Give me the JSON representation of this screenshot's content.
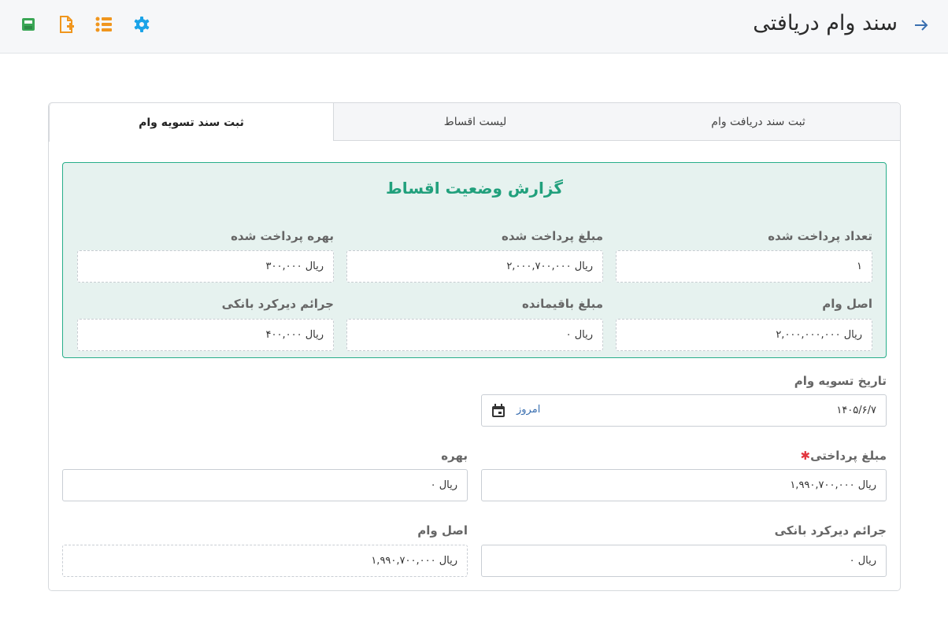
{
  "header": {
    "title": "سند وام دریافتی",
    "back_icon": "arrow-right-icon",
    "toolbar_icons": [
      "settings-icon",
      "list-icon",
      "new-document-icon",
      "save-icon"
    ]
  },
  "tabs": [
    {
      "label": "ثبت سند دریافت وام"
    },
    {
      "label": "لیست اقساط"
    },
    {
      "label": "ثبت سند تسویه وام",
      "active": true
    }
  ],
  "report": {
    "title": "گزارش وضعیت اقساط",
    "fields": [
      {
        "label": "تعداد پرداخت شده",
        "value": "۱"
      },
      {
        "label": "مبلغ پرداخت شده",
        "value": "ریال ۲,۰۰۰,۷۰۰,۰۰۰"
      },
      {
        "label": "بهره پرداخت شده",
        "value": "ریال ۳۰۰,۰۰۰"
      },
      {
        "label": "اصل وام",
        "value": "ریال ۲,۰۰۰,۰۰۰,۰۰۰"
      },
      {
        "label": "مبلغ باقیمانده",
        "value": "ریال ۰"
      },
      {
        "label": "جرائم دیرکرد بانکی",
        "value": "ریال ۴۰۰,۰۰۰"
      }
    ]
  },
  "form": {
    "settle_date": {
      "label": "تاریخ تسویه وام",
      "value": "۱۴۰۵/۶/۷",
      "today": "امروز"
    },
    "payment": {
      "label": "مبلغ پرداختی",
      "required_mark": "✱",
      "value": "ریال ۱,۹۹۰,۷۰۰,۰۰۰"
    },
    "interest": {
      "label": "بهره",
      "value": "ریال ۰"
    },
    "penalty": {
      "label": "جرائم دیرکرد بانکی",
      "value": "ریال ۰"
    },
    "principal": {
      "label": "اصل وام",
      "value": "ریال ۱,۹۹۰,۷۰۰,۰۰۰"
    }
  },
  "colors": {
    "accent_green": "#21a07c",
    "save_icon": "#3aa655",
    "orange_icons": "#f0961e",
    "settings_icon": "#1aa3e8",
    "back_arrow": "#3a6fb0"
  }
}
